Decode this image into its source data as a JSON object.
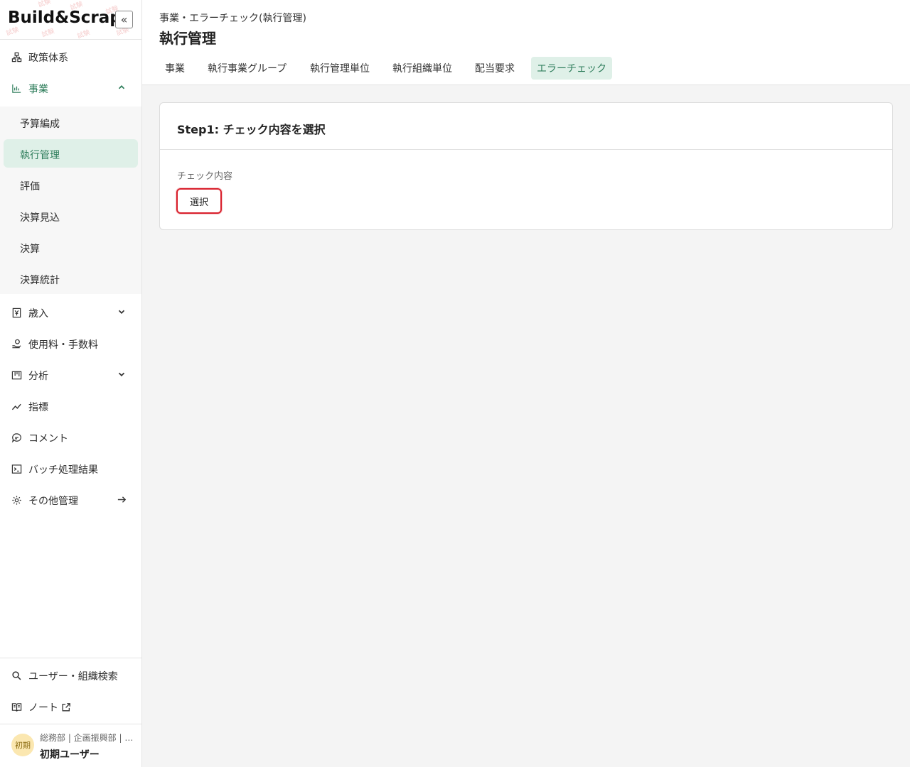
{
  "app": {
    "logo_text": "Build&Scrap",
    "collapse_glyph": "«"
  },
  "sidebar": {
    "items": [
      {
        "label": "政策体系",
        "icon": "hierarchy-icon"
      },
      {
        "label": "事業",
        "icon": "bar-chart-icon",
        "expanded": true
      },
      {
        "label": "歳入",
        "icon": "yen-document-icon"
      },
      {
        "label": "使用料・手数料",
        "icon": "hand-coin-icon"
      },
      {
        "label": "分析",
        "icon": "board-icon"
      },
      {
        "label": "指標",
        "icon": "trend-line-icon"
      },
      {
        "label": "コメント",
        "icon": "comment-icon"
      },
      {
        "label": "バッチ処理結果",
        "icon": "terminal-icon"
      },
      {
        "label": "その他管理",
        "icon": "gear-icon"
      }
    ],
    "sub_items": [
      {
        "label": "予算編成"
      },
      {
        "label": "執行管理",
        "selected": true
      },
      {
        "label": "評価"
      },
      {
        "label": "決算見込"
      },
      {
        "label": "決算"
      },
      {
        "label": "決算統計"
      }
    ],
    "bottom_items": [
      {
        "label": "ユーザー・組織検索",
        "icon": "search-icon"
      },
      {
        "label": "ノート",
        "icon": "book-icon"
      }
    ],
    "user": {
      "avatar_text": "初期",
      "department": "総務部 | 企画振興部 | …",
      "name": "初期ユーザー"
    }
  },
  "header": {
    "breadcrumb": "事業・エラーチェック(執行管理)",
    "title": "執行管理",
    "tabs": [
      {
        "label": "事業"
      },
      {
        "label": "執行事業グループ"
      },
      {
        "label": "執行管理単位"
      },
      {
        "label": "執行組織単位"
      },
      {
        "label": "配当要求"
      },
      {
        "label": "エラーチェック",
        "active": true
      }
    ]
  },
  "card": {
    "title": "Step1: チェック内容を選択",
    "field_label": "チェック内容",
    "select_button": "選択"
  },
  "colors": {
    "accent": "#2e7d5b",
    "accent_bg": "#dff0e8",
    "highlight_border": "#d9202c",
    "page_bg": "#f4f4f4"
  }
}
